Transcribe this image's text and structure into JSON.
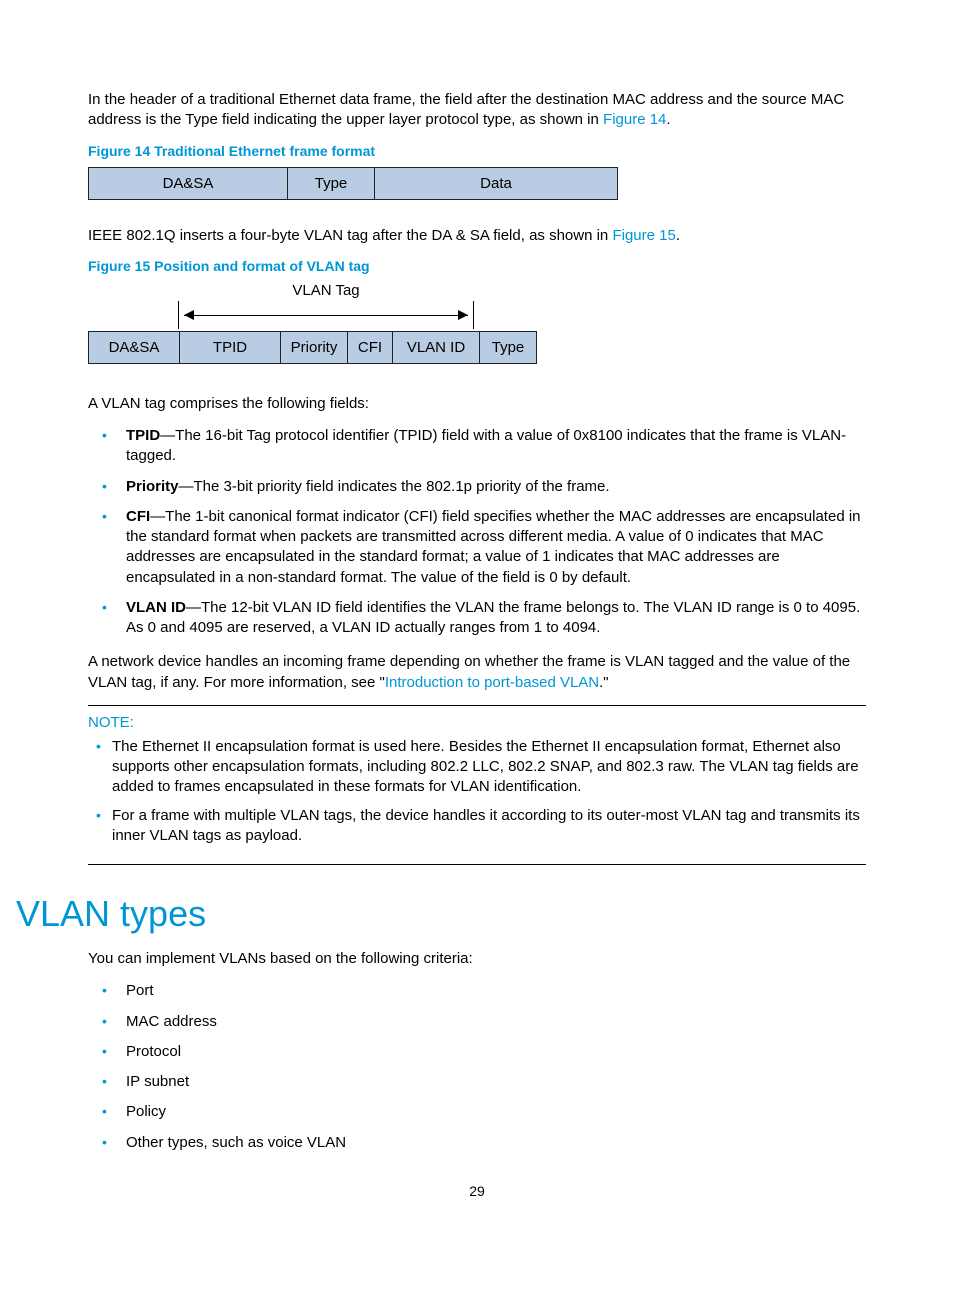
{
  "intro1_a": "In the header of a traditional Ethernet data frame, the field after the destination MAC address and the source MAC address is the Type field indicating the upper layer protocol type, as shown in ",
  "intro1_link": "Figure 14",
  "intro1_b": ".",
  "fig14_caption": "Figure 14 Traditional Ethernet frame format",
  "fig14": {
    "c1": "DA&SA",
    "c2": "Type",
    "c3": "Data"
  },
  "intro2_a": "IEEE 802.1Q inserts a four-byte VLAN tag after the DA & SA field, as shown in ",
  "intro2_link": "Figure 15",
  "intro2_b": ".",
  "fig15_caption": "Figure 15 Position and format of VLAN tag",
  "fig15_label": "VLAN Tag",
  "fig15": {
    "c1": "DA&SA",
    "c2": "TPID",
    "c3": "Priority",
    "c4": "CFI",
    "c5": "VLAN ID",
    "c6": "Type"
  },
  "fields_intro": "A VLAN tag comprises the following fields:",
  "fields": [
    {
      "term": "TPID",
      "text": "—The 16-bit Tag protocol identifier (TPID) field with a value of 0x8100 indicates that the frame is VLAN-tagged."
    },
    {
      "term": "Priority",
      "text": "—The 3-bit priority field indicates the 802.1p priority of the frame."
    },
    {
      "term": "CFI",
      "text": "—The 1-bit canonical format indicator (CFI) field specifies whether the MAC addresses are encapsulated in the standard format when packets are transmitted across different media. A value of 0 indicates that MAC addresses are encapsulated in the standard format; a value of 1 indicates that MAC addresses are encapsulated in a non-standard format. The value of the field is 0 by default."
    },
    {
      "term": "VLAN ID",
      "text": "—The 12-bit VLAN ID field identifies the VLAN the frame belongs to. The VLAN ID range is 0 to 4095. As 0 and 4095 are reserved, a VLAN ID actually ranges from 1 to 4094."
    }
  ],
  "handle_a": "A network device handles an incoming frame depending on whether the frame is VLAN tagged and the value of the VLAN tag, if any. For more information, see \"",
  "handle_link": "Introduction to port-based VLAN",
  "handle_b": ".\"",
  "note_label": "NOTE:",
  "notes": [
    "The Ethernet II encapsulation format is used here. Besides the Ethernet II encapsulation format, Ethernet also supports other encapsulation formats, including 802.2 LLC, 802.2 SNAP, and 802.3 raw. The VLAN tag fields are added to frames encapsulated in these formats for VLAN identification.",
    "For a frame with multiple VLAN tags, the device handles it according to its outer-most VLAN tag and transmits its inner VLAN tags as payload."
  ],
  "section_heading": "VLAN types",
  "types_intro": "You can implement VLANs based on the following criteria:",
  "types": [
    "Port",
    "MAC address",
    "Protocol",
    "IP subnet",
    "Policy",
    "Other types, such as voice VLAN"
  ],
  "page_number": "29"
}
